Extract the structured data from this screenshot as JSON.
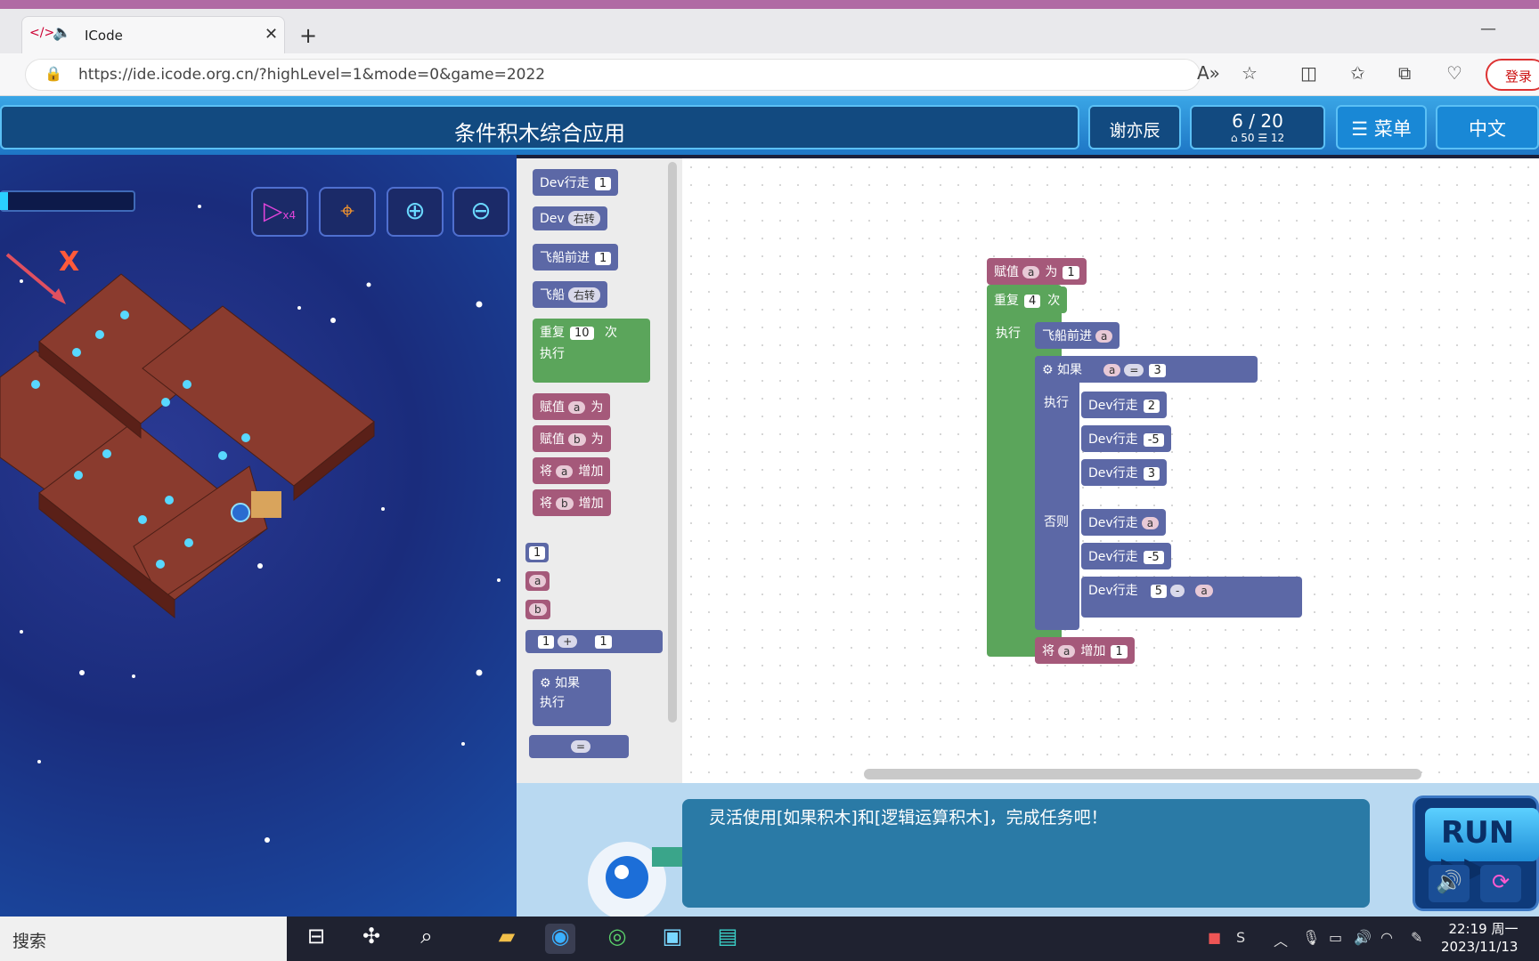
{
  "browser": {
    "tab_title": "ICode",
    "new_tab": "+",
    "url": "https://ide.icode.org.cn/?highLevel=1&mode=0&game=2022",
    "login_label": "登录",
    "minimize": "—"
  },
  "header": {
    "title": "条件积木综合应用",
    "user": "谢亦辰",
    "level": "6 / 20",
    "level_sub": "⌂ 50  ☰ 12",
    "menu_label": "☰ 菜单",
    "lang_label": "中文"
  },
  "game": {
    "marker": "X",
    "speed_label": "x4",
    "progress": 0.06
  },
  "toolbox": {
    "dev_walk": "Dev行走",
    "dev_walk_val": "1",
    "dev": "Dev",
    "turn_right": "右转",
    "ship_forward": "飞船前进",
    "ship_forward_val": "1",
    "ship": "飞船",
    "repeat": "重复",
    "repeat_val": "10",
    "times": "次",
    "exec": "执行",
    "assign": "赋值",
    "var_a": "a",
    "var_b": "b",
    "as": "为",
    "set": "将",
    "increase": "增加",
    "num_1": "1",
    "plus": "+",
    "if": "如果",
    "eq": "="
  },
  "program": {
    "assign": "赋值",
    "var": "a",
    "as": "为",
    "init": "1",
    "repeat": "重复",
    "repeat_n": "4",
    "times": "次",
    "exec": "执行",
    "ship_forward": "飞船前进",
    "if": "如果",
    "eq": "=",
    "cmp_val": "3",
    "then_label": "执行",
    "then_steps": [
      "2",
      "-5",
      "3"
    ],
    "else_label": "否则",
    "dev_walk": "Dev行走",
    "else_step2": "-5",
    "five": "5",
    "minus": "-",
    "set": "将",
    "increase": "增加",
    "inc_val": "1"
  },
  "bottom": {
    "message": "灵活使用[如果积木]和[逻辑运算积木]，完成任务吧！",
    "run_label": "RUN"
  },
  "taskbar": {
    "search": "搜索",
    "time": "22:19 周一",
    "date": "2023/11/13"
  }
}
